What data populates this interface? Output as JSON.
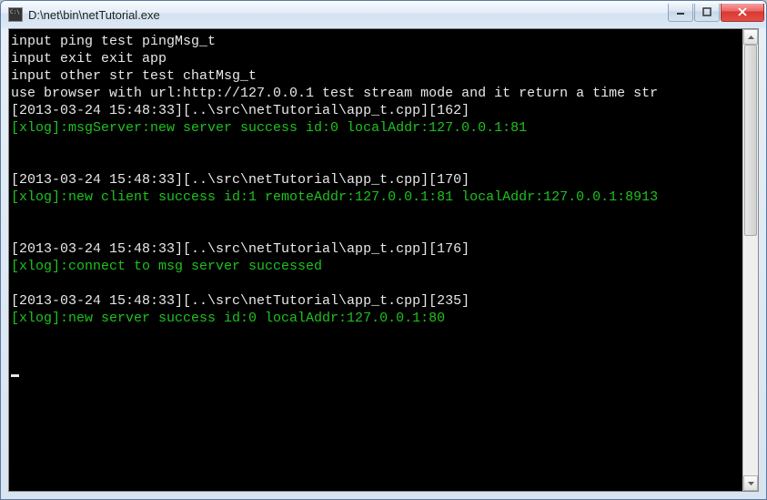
{
  "window": {
    "title": "D:\\net\\bin\\netTutorial.exe"
  },
  "console": {
    "lines": [
      {
        "text": "input ping test pingMsg_t",
        "cls": ""
      },
      {
        "text": "input exit exit app",
        "cls": ""
      },
      {
        "text": "input other str test chatMsg_t",
        "cls": ""
      },
      {
        "text": "use browser with url:http://127.0.0.1 test stream mode and it return a time str",
        "cls": ""
      },
      {
        "text": "[2013-03-24 15:48:33][..\\src\\netTutorial\\app_t.cpp][162]",
        "cls": ""
      },
      {
        "text": "[xlog]:msgServer:new server success id:0 localAddr:127.0.0.1:81",
        "cls": "g"
      },
      {
        "text": "",
        "cls": ""
      },
      {
        "text": "",
        "cls": ""
      },
      {
        "text": "[2013-03-24 15:48:33][..\\src\\netTutorial\\app_t.cpp][170]",
        "cls": ""
      },
      {
        "text": "[xlog]:new client success id:1 remoteAddr:127.0.0.1:81 localAddr:127.0.0.1:8913",
        "cls": "g"
      },
      {
        "text": "",
        "cls": ""
      },
      {
        "text": "",
        "cls": ""
      },
      {
        "text": "[2013-03-24 15:48:33][..\\src\\netTutorial\\app_t.cpp][176]",
        "cls": ""
      },
      {
        "text": "[xlog]:connect to msg server successed",
        "cls": "g"
      },
      {
        "text": "",
        "cls": ""
      },
      {
        "text": "[2013-03-24 15:48:33][..\\src\\netTutorial\\app_t.cpp][235]",
        "cls": ""
      },
      {
        "text": "[xlog]:new server success id:0 localAddr:127.0.0.1:80",
        "cls": "g"
      },
      {
        "text": "",
        "cls": ""
      },
      {
        "text": "",
        "cls": ""
      }
    ]
  }
}
